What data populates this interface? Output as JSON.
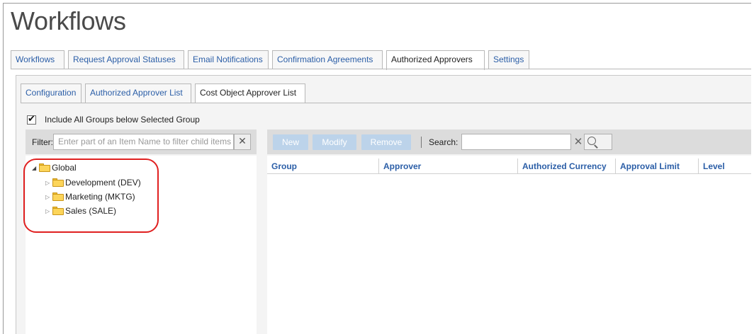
{
  "page": {
    "title": "Workflows"
  },
  "top_tabs": [
    {
      "label": "Workflows",
      "active": false
    },
    {
      "label": "Request Approval Statuses",
      "active": false
    },
    {
      "label": "Email Notifications",
      "active": false
    },
    {
      "label": "Confirmation Agreements",
      "active": false
    },
    {
      "label": "Authorized Approvers",
      "active": true
    },
    {
      "label": "Settings",
      "active": false
    }
  ],
  "sub_tabs": [
    {
      "label": "Configuration",
      "active": false
    },
    {
      "label": "Authorized Approver List",
      "active": false
    },
    {
      "label": "Cost Object Approver List",
      "active": true
    }
  ],
  "include_groups": {
    "label": "Include All Groups below Selected Group",
    "checked": true
  },
  "filter": {
    "label": "Filter:",
    "placeholder": "Enter part of an Item Name to filter child items"
  },
  "tree": {
    "root": {
      "label": "Global",
      "expanded": true
    },
    "children": [
      {
        "label": "Development (DEV)",
        "expanded": false
      },
      {
        "label": "Marketing (MKTG)",
        "expanded": false
      },
      {
        "label": "Sales (SALE)",
        "expanded": false
      }
    ]
  },
  "toolbar": {
    "new_label": "New",
    "modify_label": "Modify",
    "remove_label": "Remove",
    "search_label": "Search:",
    "search_value": ""
  },
  "grid": {
    "columns": [
      "Group",
      "Approver",
      "Authorized Currency",
      "Approval Limit",
      "Level"
    ],
    "rows": []
  },
  "colors": {
    "link_blue": "#2b5ea7",
    "disabled_button": "#bcd3ea",
    "highlight_ring": "#e02020",
    "folder_yellow": "#fcd55a"
  },
  "icons": {
    "checkbox": "check-icon",
    "filter_clear": "close-icon",
    "search_clear": "close-icon",
    "search_button": "search-icon",
    "tree_expanded": "triangle-down-icon",
    "tree_collapsed": "triangle-right-icon",
    "folder": "folder-icon"
  }
}
